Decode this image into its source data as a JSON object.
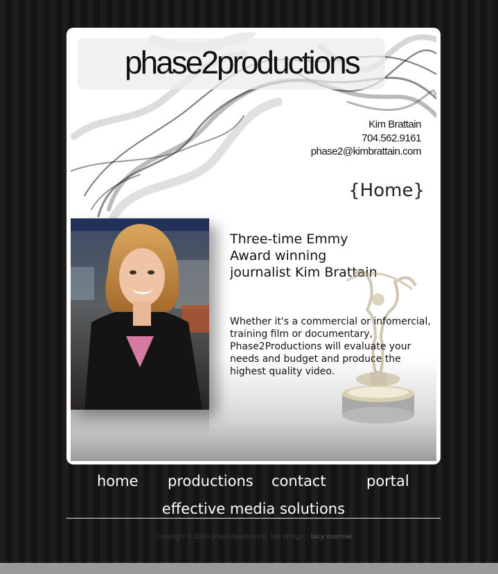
{
  "brand": {
    "logo_text": "phase2productions"
  },
  "contact": {
    "name": "Kim Brattain",
    "phone": "704.562.9161",
    "email": "phase2@kimbrattain.com"
  },
  "page": {
    "heading": "{Home}"
  },
  "main": {
    "headline_lines": [
      "Three-time Emmy",
      "Award winning",
      "journalist Kim Brattain"
    ],
    "body": "Whether it's a commercial or infomercial, training film or documentary, Phase2Productions will evaluate your needs and budget and produce the highest quality video."
  },
  "nav": {
    "items": [
      {
        "label": "home"
      },
      {
        "label": "productions"
      },
      {
        "label": "contact"
      },
      {
        "label": "portal"
      }
    ]
  },
  "tagline": "effective media solutions",
  "footer": {
    "copyright": "Copyright © 2008 phase2produtions. site design ::",
    "designer": "lacy morrow"
  },
  "icons": {
    "smoke": "smoke-graphic",
    "trophy": "emmy-trophy-icon"
  },
  "colors": {
    "background": "#1b1b1b",
    "panel": "#ffffff",
    "nav_text": "#ffffff"
  }
}
